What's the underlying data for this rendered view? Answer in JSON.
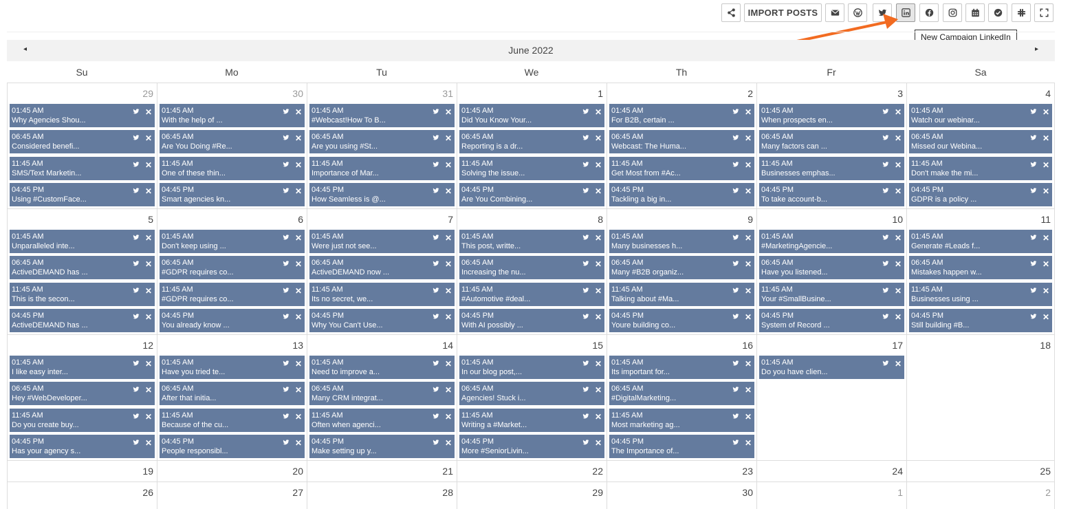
{
  "toolbar": {
    "import_label": "IMPORT POSTS",
    "tooltip": "New Campaign LinkedIn",
    "icons": [
      "share-icon",
      "email-icon",
      "wordpress-icon",
      "twitter-icon",
      "linkedin-icon",
      "facebook-icon",
      "instagram-icon",
      "calendar-icon",
      "check-circle-icon",
      "slack-icon",
      "fullscreen-icon"
    ],
    "active_icon": "linkedin-icon"
  },
  "calendar": {
    "title": "June 2022",
    "prev_label": "◂",
    "next_label": "▸",
    "days_of_week": [
      "Su",
      "Mo",
      "Tu",
      "We",
      "Th",
      "Fr",
      "Sa"
    ],
    "weeks": [
      [
        {
          "day": "29",
          "other": true,
          "events": [
            {
              "time": "01:45 AM",
              "title": "Why Agencies Shou..."
            },
            {
              "time": "06:45 AM",
              "title": "Considered benefi..."
            },
            {
              "time": "11:45 AM",
              "title": "SMS/Text Marketin..."
            },
            {
              "time": "04:45 PM",
              "title": "Using #CustomFace..."
            }
          ]
        },
        {
          "day": "30",
          "other": true,
          "events": [
            {
              "time": "01:45 AM",
              "title": "With the help of ..."
            },
            {
              "time": "06:45 AM",
              "title": "Are You Doing #Re..."
            },
            {
              "time": "11:45 AM",
              "title": "One of these thin..."
            },
            {
              "time": "04:45 PM",
              "title": "Smart agencies kn..."
            }
          ]
        },
        {
          "day": "31",
          "other": true,
          "events": [
            {
              "time": "01:45 AM",
              "title": "#Webcast!How To B..."
            },
            {
              "time": "06:45 AM",
              "title": "Are you using #St..."
            },
            {
              "time": "11:45 AM",
              "title": "Importance of Mar..."
            },
            {
              "time": "04:45 PM",
              "title": "How Seamless is @..."
            }
          ]
        },
        {
          "day": "1",
          "events": [
            {
              "time": "01:45 AM",
              "title": "Did You Know Your..."
            },
            {
              "time": "06:45 AM",
              "title": "Reporting is a dr..."
            },
            {
              "time": "11:45 AM",
              "title": "Solving the issue..."
            },
            {
              "time": "04:45 PM",
              "title": "Are You Combining..."
            }
          ]
        },
        {
          "day": "2",
          "events": [
            {
              "time": "01:45 AM",
              "title": "For B2B, certain ..."
            },
            {
              "time": "06:45 AM",
              "title": "Webcast: The Huma..."
            },
            {
              "time": "11:45 AM",
              "title": "Get Most from #Ac..."
            },
            {
              "time": "04:45 PM",
              "title": "Tackling a big in..."
            }
          ]
        },
        {
          "day": "3",
          "events": [
            {
              "time": "01:45 AM",
              "title": "When prospects en..."
            },
            {
              "time": "06:45 AM",
              "title": "Many factors can ..."
            },
            {
              "time": "11:45 AM",
              "title": "Businesses emphas..."
            },
            {
              "time": "04:45 PM",
              "title": "To take account-b..."
            }
          ]
        },
        {
          "day": "4",
          "events": [
            {
              "time": "01:45 AM",
              "title": "Watch our webinar..."
            },
            {
              "time": "06:45 AM",
              "title": "Missed our Webina..."
            },
            {
              "time": "11:45 AM",
              "title": "Don't make the mi..."
            },
            {
              "time": "04:45 PM",
              "title": "GDPR is a policy ..."
            }
          ]
        }
      ],
      [
        {
          "day": "5",
          "events": [
            {
              "time": "01:45 AM",
              "title": "Unparalleled inte..."
            },
            {
              "time": "06:45 AM",
              "title": "ActiveDEMAND has ..."
            },
            {
              "time": "11:45 AM",
              "title": "This is the secon..."
            },
            {
              "time": "04:45 PM",
              "title": "ActiveDEMAND has ..."
            }
          ]
        },
        {
          "day": "6",
          "events": [
            {
              "time": "01:45 AM",
              "title": "Don't keep using ..."
            },
            {
              "time": "06:45 AM",
              "title": "#GDPR requires co..."
            },
            {
              "time": "11:45 AM",
              "title": "#GDPR requires co..."
            },
            {
              "time": "04:45 PM",
              "title": "You already know ..."
            }
          ]
        },
        {
          "day": "7",
          "events": [
            {
              "time": "01:45 AM",
              "title": "Were just not see..."
            },
            {
              "time": "06:45 AM",
              "title": "ActiveDEMAND now ..."
            },
            {
              "time": "11:45 AM",
              "title": "Its no secret, we..."
            },
            {
              "time": "04:45 PM",
              "title": "Why You Can't Use..."
            }
          ]
        },
        {
          "day": "8",
          "events": [
            {
              "time": "01:45 AM",
              "title": "This post, writte..."
            },
            {
              "time": "06:45 AM",
              "title": "Increasing the nu..."
            },
            {
              "time": "11:45 AM",
              "title": "#Automotive #deal..."
            },
            {
              "time": "04:45 PM",
              "title": "With AI possibly ..."
            }
          ]
        },
        {
          "day": "9",
          "events": [
            {
              "time": "01:45 AM",
              "title": "Many businesses h..."
            },
            {
              "time": "06:45 AM",
              "title": "Many #B2B organiz..."
            },
            {
              "time": "11:45 AM",
              "title": "Talking about #Ma..."
            },
            {
              "time": "04:45 PM",
              "title": "Youre building co..."
            }
          ]
        },
        {
          "day": "10",
          "events": [
            {
              "time": "01:45 AM",
              "title": "#MarketingAgencie..."
            },
            {
              "time": "06:45 AM",
              "title": "Have you listened..."
            },
            {
              "time": "11:45 AM",
              "title": "Your #SmallBusine..."
            },
            {
              "time": "04:45 PM",
              "title": "System of Record ..."
            }
          ]
        },
        {
          "day": "11",
          "events": [
            {
              "time": "01:45 AM",
              "title": "Generate #Leads f..."
            },
            {
              "time": "06:45 AM",
              "title": "Mistakes happen w..."
            },
            {
              "time": "11:45 AM",
              "title": "Businesses using ..."
            },
            {
              "time": "04:45 PM",
              "title": "Still building #B..."
            }
          ]
        }
      ],
      [
        {
          "day": "12",
          "events": [
            {
              "time": "01:45 AM",
              "title": "I like easy inter..."
            },
            {
              "time": "06:45 AM",
              "title": "Hey #WebDeveloper..."
            },
            {
              "time": "11:45 AM",
              "title": "Do you create buy..."
            },
            {
              "time": "04:45 PM",
              "title": "Has your agency s..."
            }
          ]
        },
        {
          "day": "13",
          "events": [
            {
              "time": "01:45 AM",
              "title": "Have you tried te..."
            },
            {
              "time": "06:45 AM",
              "title": "After that initia..."
            },
            {
              "time": "11:45 AM",
              "title": "Because of the cu..."
            },
            {
              "time": "04:45 PM",
              "title": "People responsibl..."
            }
          ]
        },
        {
          "day": "14",
          "events": [
            {
              "time": "01:45 AM",
              "title": "Need to improve a..."
            },
            {
              "time": "06:45 AM",
              "title": "Many CRM integrat..."
            },
            {
              "time": "11:45 AM",
              "title": "Often when agenci..."
            },
            {
              "time": "04:45 PM",
              "title": "Make setting up y..."
            }
          ]
        },
        {
          "day": "15",
          "events": [
            {
              "time": "01:45 AM",
              "title": "In our blog post,..."
            },
            {
              "time": "06:45 AM",
              "title": "Agencies! Stuck i..."
            },
            {
              "time": "11:45 AM",
              "title": "Writing a #Market..."
            },
            {
              "time": "04:45 PM",
              "title": "More #SeniorLivin..."
            }
          ]
        },
        {
          "day": "16",
          "events": [
            {
              "time": "01:45 AM",
              "title": "Its important for..."
            },
            {
              "time": "06:45 AM",
              "title": "#DigitalMarketing..."
            },
            {
              "time": "11:45 AM",
              "title": "Most marketing ag..."
            },
            {
              "time": "04:45 PM",
              "title": "The Importance of..."
            }
          ]
        },
        {
          "day": "17",
          "events": [
            {
              "time": "01:45 AM",
              "title": "Do you have clien..."
            }
          ]
        },
        {
          "day": "18",
          "events": []
        }
      ],
      [
        {
          "day": "19",
          "events": []
        },
        {
          "day": "20",
          "events": []
        },
        {
          "day": "21",
          "events": []
        },
        {
          "day": "22",
          "events": []
        },
        {
          "day": "23",
          "events": []
        },
        {
          "day": "24",
          "events": []
        },
        {
          "day": "25",
          "events": []
        }
      ],
      [
        {
          "day": "26",
          "events": []
        },
        {
          "day": "27",
          "events": []
        },
        {
          "day": "28",
          "events": []
        },
        {
          "day": "29",
          "events": []
        },
        {
          "day": "30",
          "events": []
        },
        {
          "day": "1",
          "other": true,
          "events": []
        },
        {
          "day": "2",
          "other": true,
          "events": []
        }
      ]
    ]
  },
  "colors": {
    "event_bg": "#647b9e",
    "arrow": "#f26b21"
  }
}
